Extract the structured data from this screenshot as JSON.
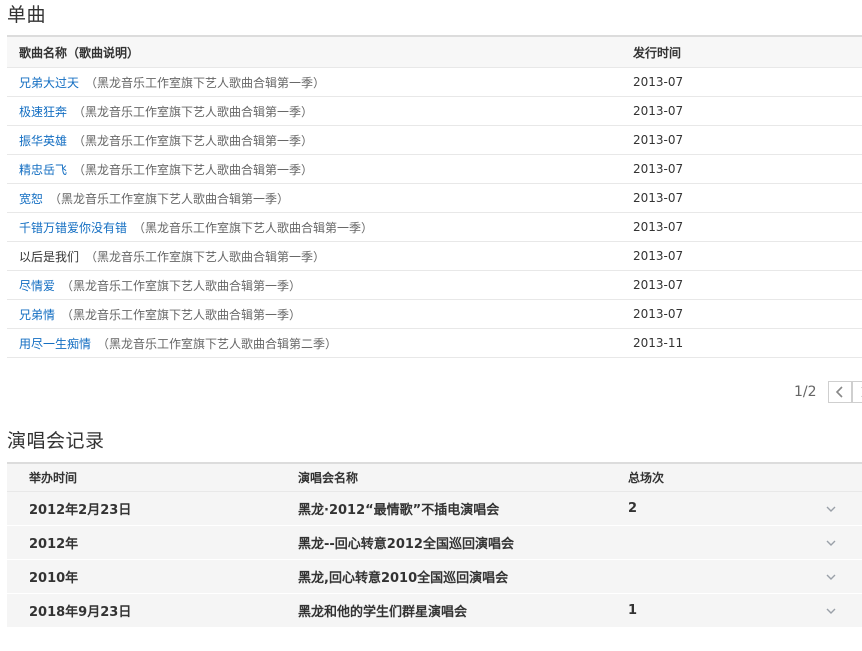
{
  "singles": {
    "title": "单曲",
    "header": {
      "name": "歌曲名称（歌曲说明）",
      "date": "发行时间"
    },
    "rows": [
      {
        "name": "兄弟大过天",
        "desc": "（黑龙音乐工作室旗下艺人歌曲合辑第一季）",
        "date": "2013-07",
        "linked": true
      },
      {
        "name": "极速狂奔",
        "desc": "（黑龙音乐工作室旗下艺人歌曲合辑第一季）",
        "date": "2013-07",
        "linked": true
      },
      {
        "name": "振华英雄",
        "desc": "（黑龙音乐工作室旗下艺人歌曲合辑第一季）",
        "date": "2013-07",
        "linked": true
      },
      {
        "name": "精忠岳飞",
        "desc": "（黑龙音乐工作室旗下艺人歌曲合辑第一季）",
        "date": "2013-07",
        "linked": true
      },
      {
        "name": "宽恕",
        "desc": "（黑龙音乐工作室旗下艺人歌曲合辑第一季）",
        "date": "2013-07",
        "linked": true
      },
      {
        "name": "千错万错爱你没有错",
        "desc": "（黑龙音乐工作室旗下艺人歌曲合辑第一季）",
        "date": "2013-07",
        "linked": true
      },
      {
        "name": "以后是我们",
        "desc": "（黑龙音乐工作室旗下艺人歌曲合辑第一季）",
        "date": "2013-07",
        "linked": false
      },
      {
        "name": "尽情爱",
        "desc": "（黑龙音乐工作室旗下艺人歌曲合辑第一季）",
        "date": "2013-07",
        "linked": true
      },
      {
        "name": "兄弟情",
        "desc": "（黑龙音乐工作室旗下艺人歌曲合辑第一季）",
        "date": "2013-07",
        "linked": true
      },
      {
        "name": "用尽一生痴情",
        "desc": "（黑龙音乐工作室旗下艺人歌曲合辑第二季）",
        "date": "2013-11",
        "linked": true
      }
    ],
    "pager": {
      "text": "1/2",
      "prev_icon": "chevron-left-icon",
      "next_icon": "chevron-right-icon"
    }
  },
  "concerts": {
    "title": "演唱会记录",
    "header": {
      "date": "举办时间",
      "name": "演唱会名称",
      "count": "总场次"
    },
    "rows": [
      {
        "date": "2012年2月23日",
        "name": "黑龙·2012“最情歌”不插电演唱会",
        "count": "2"
      },
      {
        "date": "2012年",
        "name": "黑龙--回心转意2012全国巡回演唱会",
        "count": ""
      },
      {
        "date": "2010年",
        "name": "黑龙,回心转意2010全国巡回演唱会",
        "count": ""
      },
      {
        "date": "2018年9月23日",
        "name": "黑龙和他的学生们群星演唱会",
        "count": "1"
      }
    ]
  },
  "colors": {
    "link": "#136ec2",
    "header_bg": "#f7f7f7",
    "border": "#e8e8e8"
  }
}
